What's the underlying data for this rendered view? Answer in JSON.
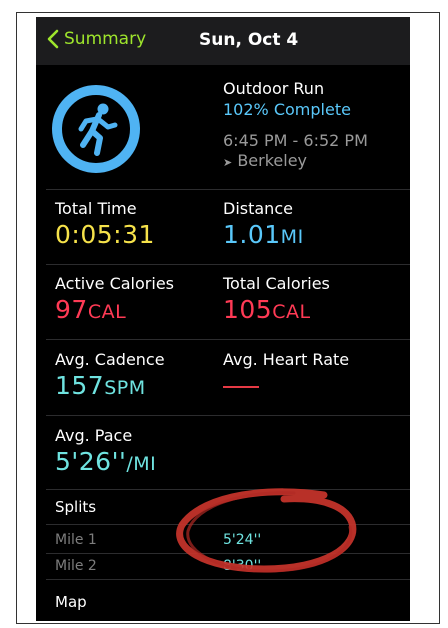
{
  "nav": {
    "back_label": "Summary",
    "title": "Sun, Oct 4"
  },
  "workout": {
    "type": "Outdoor Run",
    "completion": "102% Complete",
    "completion_fraction": 1.02,
    "time_range": "6:45 PM - 6:52 PM",
    "location": "Berkeley",
    "ring_color": "#4fb3f3"
  },
  "metrics": {
    "total_time": {
      "label": "Total Time",
      "value": "0:05:31"
    },
    "distance": {
      "label": "Distance",
      "value": "1.01",
      "unit": "MI"
    },
    "active_calories": {
      "label": "Active Calories",
      "value": "97",
      "unit": "CAL"
    },
    "total_calories": {
      "label": "Total Calories",
      "value": "105",
      "unit": "CAL"
    },
    "avg_cadence": {
      "label": "Avg. Cadence",
      "value": "157",
      "unit": "SPM"
    },
    "avg_heart_rate": {
      "label": "Avg. Heart Rate",
      "value": "—"
    },
    "avg_pace": {
      "label": "Avg. Pace",
      "value": "5'26''",
      "unit": "/MI"
    }
  },
  "splits": {
    "heading": "Splits",
    "rows": [
      {
        "label": "Mile 1",
        "value": "5'24''"
      },
      {
        "label": "Mile 2",
        "value": "8'30''"
      }
    ]
  },
  "map": {
    "heading": "Map"
  },
  "annotation": {
    "color": "#c8342b"
  }
}
